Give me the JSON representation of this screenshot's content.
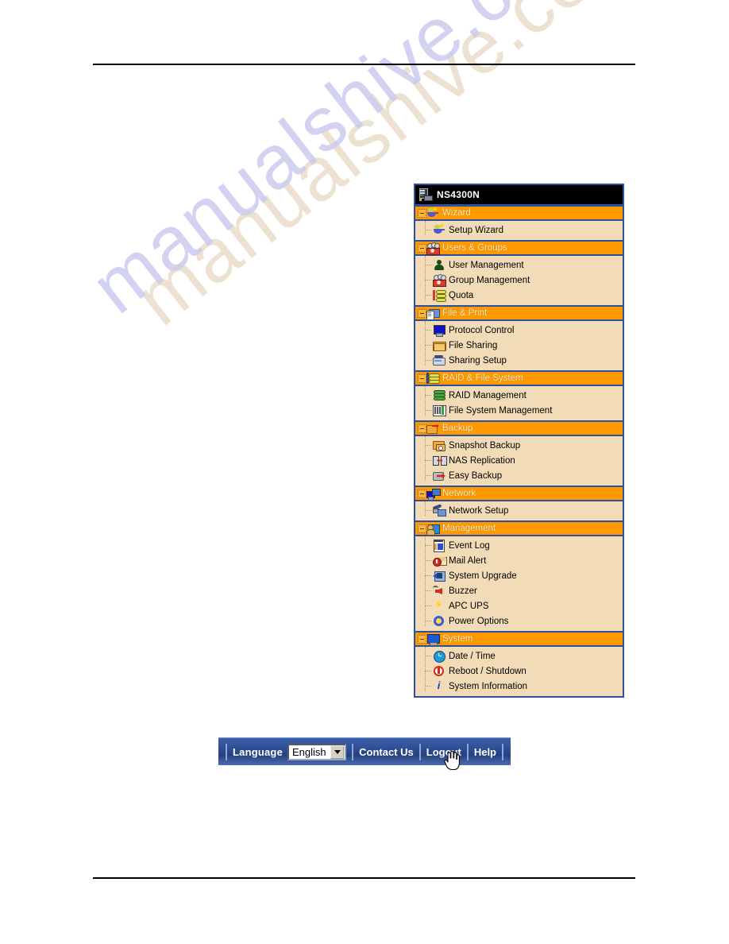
{
  "document": {
    "watermark": "manualshive.com"
  },
  "nav": {
    "title": "NS4300N",
    "title_icon": "nas-device-icon",
    "sections": [
      {
        "label": "Wizard",
        "icon": "wizard-lamp-icon",
        "items": [
          {
            "label": "Setup Wizard",
            "icon": "setup-wizard-icon"
          }
        ]
      },
      {
        "label": "Users & Groups",
        "icon": "users-group-icon",
        "items": [
          {
            "label": "User Management",
            "icon": "user-icon"
          },
          {
            "label": "Group Management",
            "icon": "group-icon"
          },
          {
            "label": "Quota",
            "icon": "quota-icon"
          }
        ]
      },
      {
        "label": "File & Print",
        "icon": "file-print-icon",
        "items": [
          {
            "label": "Protocol Control",
            "icon": "monitor-icon"
          },
          {
            "label": "File Sharing",
            "icon": "folder-icon"
          },
          {
            "label": "Sharing Setup",
            "icon": "sharing-setup-icon"
          }
        ]
      },
      {
        "label": "RAID & File System",
        "icon": "raid-stack-icon",
        "items": [
          {
            "label": "RAID Management",
            "icon": "raid-disk-icon"
          },
          {
            "label": "File System Management",
            "icon": "filesystem-icon"
          }
        ]
      },
      {
        "label": "Backup",
        "icon": "backup-folder-arrow-icon",
        "items": [
          {
            "label": "Snapshot Backup",
            "icon": "snapshot-camera-icon"
          },
          {
            "label": "NAS Replication",
            "icon": "replication-icon"
          },
          {
            "label": "Easy Backup",
            "icon": "easy-backup-icon"
          }
        ]
      },
      {
        "label": "Network",
        "icon": "network-computers-icon",
        "items": [
          {
            "label": "Network Setup",
            "icon": "network-setup-icon"
          }
        ]
      },
      {
        "label": "Management",
        "icon": "management-user-monitor-icon",
        "items": [
          {
            "label": "Event Log",
            "icon": "event-log-icon"
          },
          {
            "label": "Mail Alert",
            "icon": "mail-alert-icon"
          },
          {
            "label": "System Upgrade",
            "icon": "system-upgrade-icon"
          },
          {
            "label": "Buzzer",
            "icon": "buzzer-speaker-icon"
          },
          {
            "label": "APC UPS",
            "icon": "ups-lightning-icon"
          },
          {
            "label": "Power Options",
            "icon": "power-options-icon"
          }
        ]
      },
      {
        "label": "System",
        "icon": "system-monitor-icon",
        "items": [
          {
            "label": "Date / Time",
            "icon": "clock-icon"
          },
          {
            "label": "Reboot / Shutdown",
            "icon": "power-button-icon"
          },
          {
            "label": "System Information",
            "icon": "info-icon"
          }
        ]
      }
    ]
  },
  "toolbar": {
    "language_label": "Language",
    "language_value": "English",
    "dropdown_icon": "chevron-down-icon",
    "contact_us": "Contact Us",
    "logout": "Logout",
    "help": "Help",
    "cursor": "hand-cursor"
  },
  "colors": {
    "group_bg": "#ff9900",
    "group_text": "#ffeec2",
    "panel_bg": "#f2dcb8",
    "panel_border": "#2c4fa0",
    "title_bg": "#000000",
    "toolbar_blue": "#2f4f95",
    "watermark": "#ccccef"
  }
}
